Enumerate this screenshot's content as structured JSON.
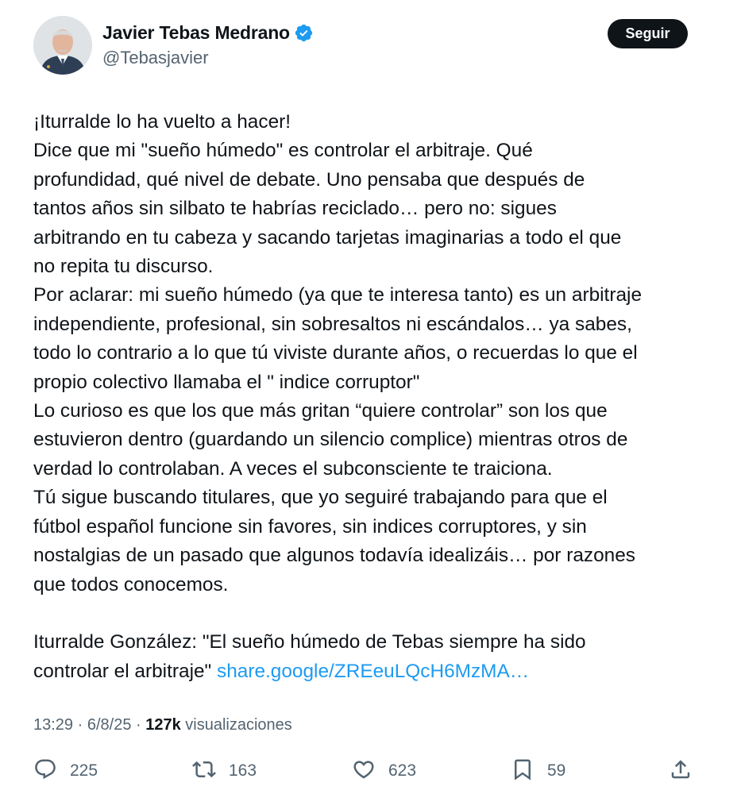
{
  "author": {
    "name": "Javier Tebas Medrano",
    "handle": "@Tebasjavier",
    "verified": true
  },
  "follow_button": {
    "label": "Seguir"
  },
  "tweet": {
    "lines": [
      "¡Iturralde lo ha vuelto a hacer!",
      "Dice que mi \"sueño húmedo\" es controlar el arbitraje. Qué",
      "profundidad, qué nivel de debate. Uno pensaba que después de",
      "tantos años sin silbato te habrías reciclado… pero no: sigues",
      "arbitrando en tu cabeza y sacando tarjetas imaginarias a todo el que",
      "no repita tu discurso.",
      "Por aclarar: mi sueño húmedo (ya que te interesa tanto) es un arbitraje",
      "independiente, profesional, sin sobresaltos ni escándalos… ya sabes,",
      "todo lo contrario a lo que tú viviste durante años, o recuerdas lo que el",
      "propio colectivo llamaba el \" indice corruptor\"",
      "Lo curioso es que los que más gritan “quiere controlar” son los que",
      "estuvieron dentro (guardando un silencio complice) mientras otros de",
      "verdad lo controlaban. A veces el subconsciente te traiciona.",
      "Tú sigue buscando titulares, que yo seguiré trabajando para que el",
      "fútbol español funcione sin favores, sin indices corruptores, y sin",
      "nostalgias de un pasado que algunos todavía idealizáis… por razones",
      "que todos conocemos."
    ],
    "quote_line_1": "Iturralde González: \"El sueño húmedo de Tebas siempre ha sido",
    "quote_line_2": "controlar el arbitraje\" ",
    "link_text": "share.google/ZREeuLQcH6MzMA…"
  },
  "meta": {
    "time": "13:29",
    "separator": " · ",
    "date": "6/8/25",
    "views_count": "127k",
    "views_label": " visualizaciones"
  },
  "actions": {
    "replies": "225",
    "reposts": "163",
    "likes": "623",
    "bookmarks": "59"
  },
  "colors": {
    "text": "#0f1419",
    "secondary": "#536471",
    "link": "#1d9bf0",
    "verified": "#1d9bf0",
    "follow_bg": "#0f1419"
  },
  "icons": [
    "verified-badge-icon",
    "reply-icon",
    "repost-icon",
    "like-icon",
    "bookmark-icon",
    "share-icon"
  ]
}
